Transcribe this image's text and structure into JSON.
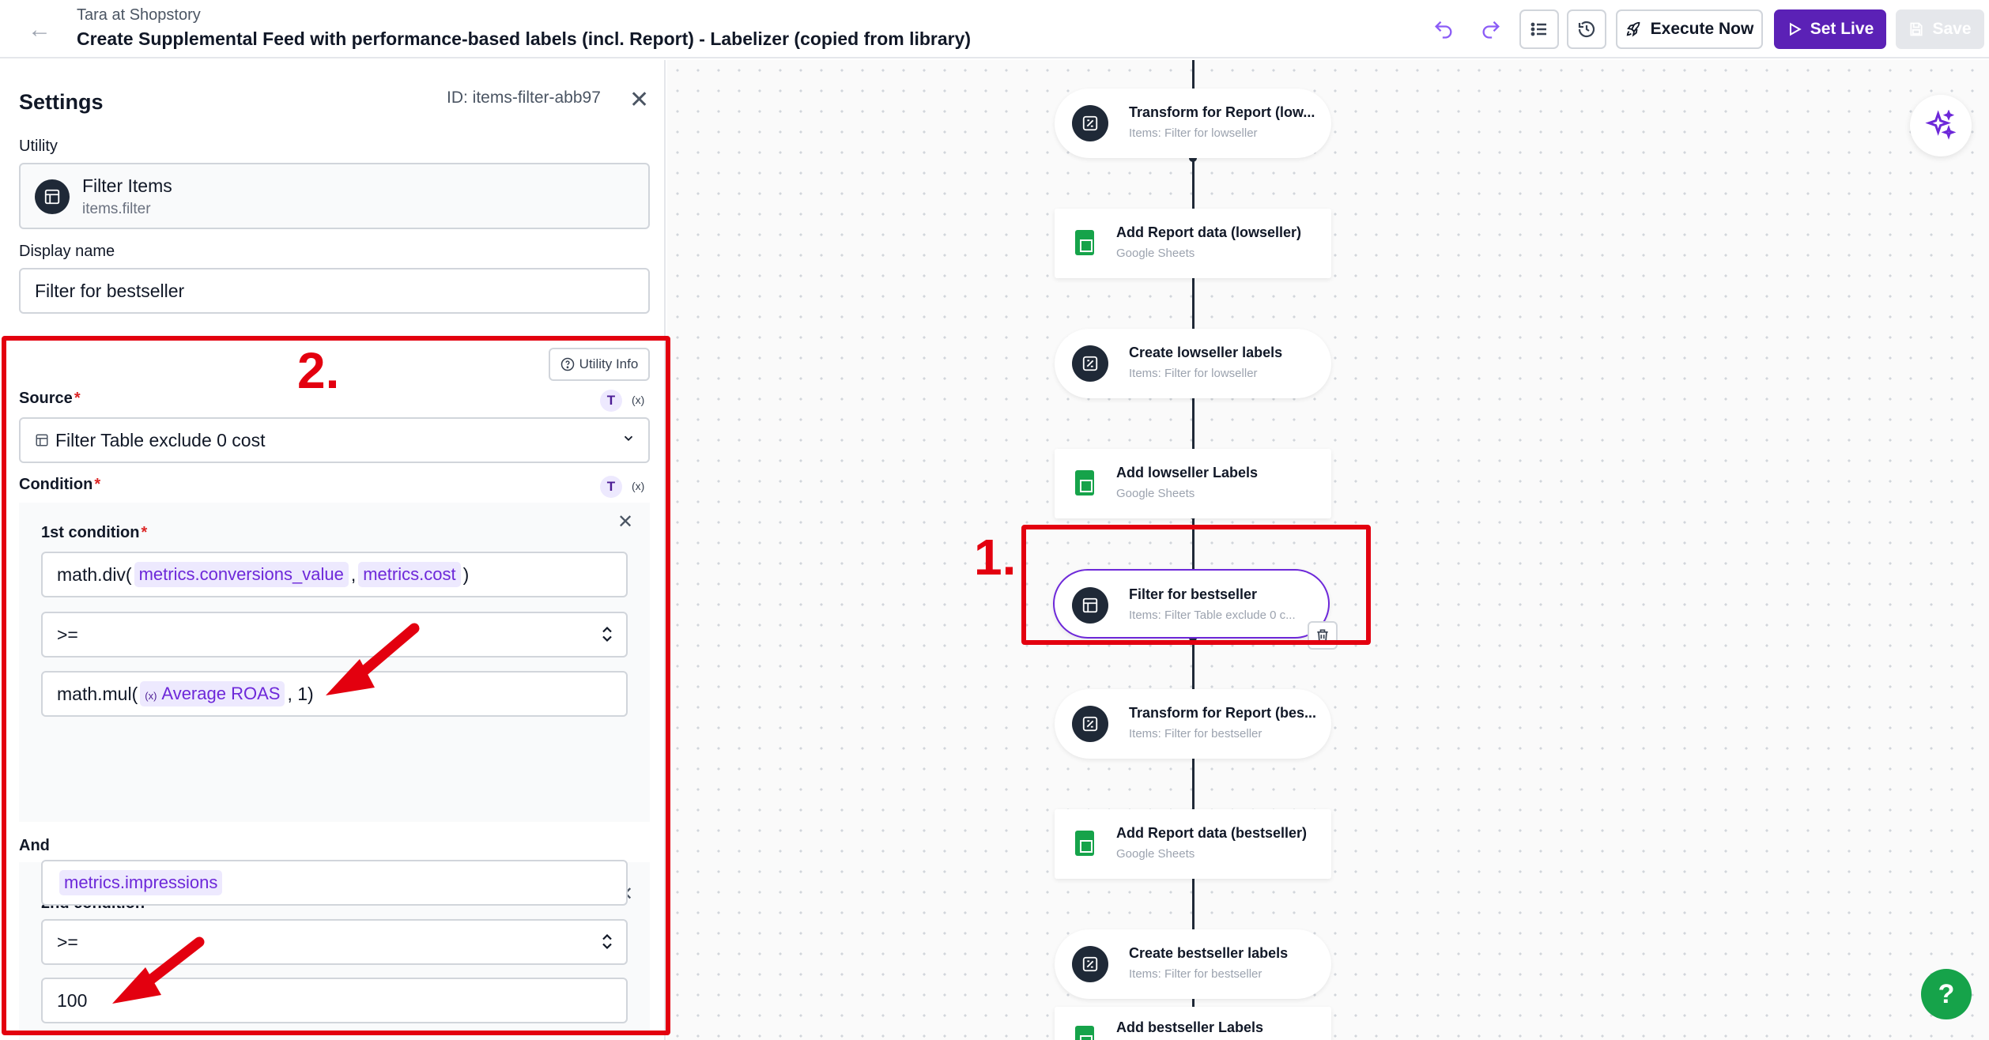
{
  "header": {
    "breadcrumb": "Tara at Shopstory",
    "title": "Create Supplemental Feed with performance-based labels (incl. Report) - Labelizer (copied from library)",
    "execute_label": "Execute Now",
    "set_live_label": "Set Live",
    "save_label": "Save"
  },
  "settings": {
    "title": "Settings",
    "node_id": "ID: items-filter-abb97",
    "utility_label": "Utility",
    "utility_name": "Filter Items",
    "utility_code": "items.filter",
    "display_name_label": "Display name",
    "display_name_value": "Filter for bestseller",
    "utility_info_label": "Utility Info",
    "source_label": "Source",
    "source_value": "Filter Table exclude 0 cost",
    "condition_label": "Condition",
    "t_badge": "T",
    "x_badge": "(x)",
    "conditions": [
      {
        "label": "1st condition",
        "left_fn": "math.div(",
        "left_arg1": "metrics.conversions_value",
        "left_sep": ",",
        "left_arg2": "metrics.cost",
        "left_close": ")",
        "operator": ">=",
        "right_fn": "math.mul(",
        "right_var_icon": "(x)",
        "right_var": "Average ROAS",
        "right_rest": ", 1)"
      },
      {
        "label": "2nd condition",
        "left_chip": "metrics.impressions",
        "operator": ">=",
        "right_value": "100"
      }
    ],
    "and_label": "And"
  },
  "workflow": {
    "nodes": [
      {
        "title": "Transform for Report (low...",
        "subtitle": "Items: Filter for lowseller",
        "kind": "transform"
      },
      {
        "title": "Add Report data (lowseller)",
        "subtitle": "Google Sheets",
        "kind": "sheets"
      },
      {
        "title": "Create lowseller labels",
        "subtitle": "Items: Filter for lowseller",
        "kind": "transform"
      },
      {
        "title": "Add lowseller Labels",
        "subtitle": "Google Sheets",
        "kind": "sheets"
      },
      {
        "title": "Filter for bestseller",
        "subtitle": "Items: Filter Table exclude 0 c...",
        "kind": "filter"
      },
      {
        "title": "Transform for Report (bes...",
        "subtitle": "Items: Filter for bestseller",
        "kind": "transform"
      },
      {
        "title": "Add Report data (bestseller)",
        "subtitle": "Google Sheets",
        "kind": "sheets"
      },
      {
        "title": "Create bestseller labels",
        "subtitle": "Items: Filter for bestseller",
        "kind": "transform"
      },
      {
        "title": "Add bestseller Labels",
        "subtitle": "Google Sheets",
        "kind": "sheets"
      }
    ]
  },
  "annotations": {
    "step1": "1.",
    "step2": "2.",
    "color": "#e3000f"
  },
  "help_label": "?"
}
